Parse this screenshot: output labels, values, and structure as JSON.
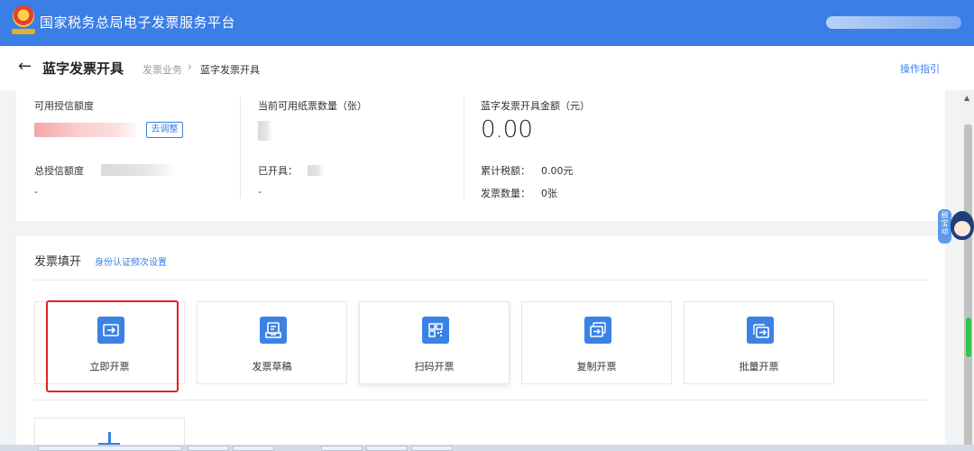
{
  "topbar": {
    "title": "国家税务总局电子发票服务平台"
  },
  "header": {
    "title": "蓝字发票开具",
    "breadcrumb": [
      "发票业务",
      "蓝字发票开具"
    ],
    "guide_link": "操作指引"
  },
  "summary": {
    "credit": {
      "label": "可用授信额度",
      "adjust_button": "去调整",
      "total_label": "总授信额度",
      "total_value": "-"
    },
    "paper": {
      "label": "当前可用纸票数量（张）",
      "issued_label": "已开具：",
      "issued_value": "-"
    },
    "blue_invoice": {
      "label": "蓝字发票开具金额（元）",
      "amount": "0.00",
      "tax_label": "累计税额：",
      "tax_value": "0.00元",
      "count_label": "发票数量：",
      "count_value": "0张"
    }
  },
  "invoice_section": {
    "title": "发票填开",
    "link": "身份认证频次设置",
    "tiles": [
      {
        "label": "立即开票",
        "icon": "ticket-arrow-icon"
      },
      {
        "label": "发票草稿",
        "icon": "document-tray-icon"
      },
      {
        "label": "扫码开票",
        "icon": "qr-code-icon"
      },
      {
        "label": "复制开票",
        "icon": "copy-ticket-icon"
      },
      {
        "label": "批量开票",
        "icon": "batch-ticket-icon"
      }
    ]
  },
  "assistant": {
    "tag": "税宝动"
  },
  "colors": {
    "brand_blue": "#3a7ee6",
    "highlight_red": "#e02020"
  }
}
